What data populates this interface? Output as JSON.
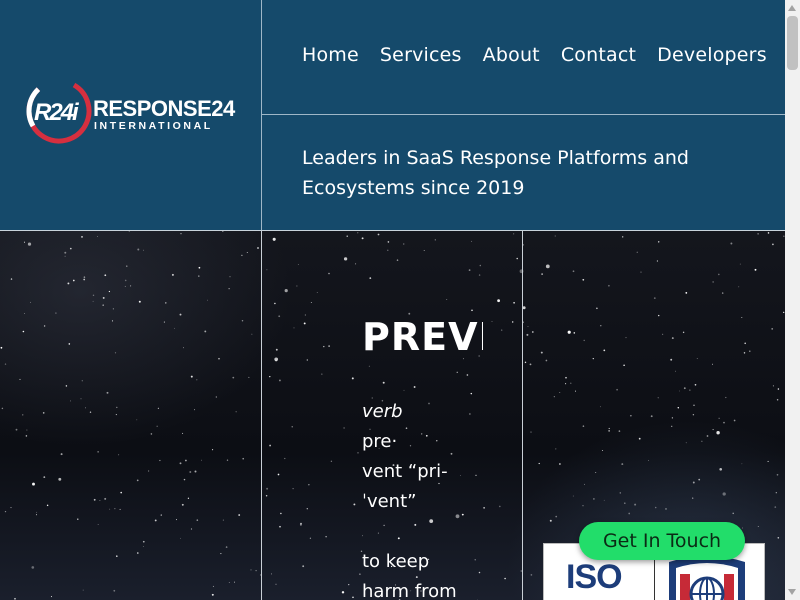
{
  "brand": {
    "logo_mark": "R24i",
    "logo_name": "RESPONSE24",
    "logo_sub": "INTERNATIONAL",
    "colors": {
      "header_bg": "#154a6b",
      "logo_red": "#d62f3f",
      "cta_green": "#22dd6a"
    }
  },
  "nav": {
    "items": [
      {
        "label": "Home"
      },
      {
        "label": "Services"
      },
      {
        "label": "About"
      },
      {
        "label": "Contact"
      },
      {
        "label": "Developers"
      }
    ]
  },
  "tagline": "Leaders in SaaS Response Platforms and Ecosystems since 2019",
  "hero": {
    "headline": "PREVE",
    "definition": {
      "part_of_speech": "verb",
      "pronunciation_lines": [
        "pre·",
        "vent “pri-",
        "ˈvent”"
      ],
      "meaning_lines": [
        "to keep",
        "harm from"
      ]
    }
  },
  "badge": {
    "iso_text": "ISO",
    "seal_icon": "us-flag-seal-icon"
  },
  "cta": {
    "label": "Get In Touch"
  }
}
